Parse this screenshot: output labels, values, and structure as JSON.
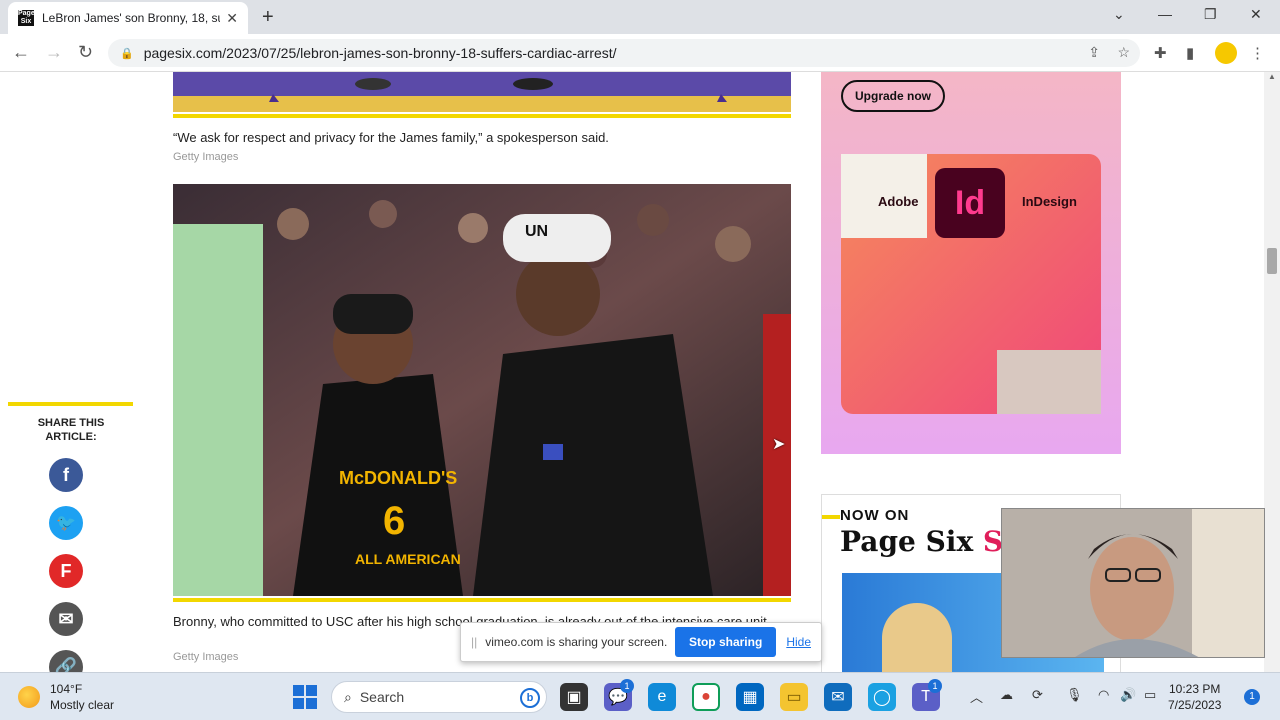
{
  "browser": {
    "tab_title": "LeBron James' son Bronny, 18, su",
    "favicon_text": "Page Six",
    "url": "pagesix.com/2023/07/25/lebron-james-son-bronny-18-suffers-cardiac-arrest/"
  },
  "article": {
    "caption1": "“We ask for respect and privacy for the James family,” a spokesperson said.",
    "credit1": "Getty Images",
    "caption2": "Bronny, who committed to USC after his high school graduation, is already out of the intensive care unit.",
    "credit2": "Getty Images",
    "jersey_text": "McDONALD'S",
    "jersey_number": "6",
    "jersey_sub": "ALL AMERICAN",
    "cap_text": "UN"
  },
  "share": {
    "title": "SHARE THIS ARTICLE:",
    "networks": [
      "facebook",
      "twitter",
      "flipboard",
      "email",
      "link"
    ]
  },
  "ad": {
    "upgrade_label": "Upgrade now",
    "brand_left": "Adobe",
    "logo": "Id",
    "brand_right": "InDesign"
  },
  "promo": {
    "now_on": "NOW ON",
    "brand": "Page Six",
    "brand_suffix": "St"
  },
  "screen_share": {
    "message": "vimeo.com is sharing your screen.",
    "stop_label": "Stop sharing",
    "hide_label": "Hide"
  },
  "taskbar": {
    "temp": "104°F",
    "condition": "Mostly clear",
    "search_label": "Search",
    "time": "10:23 PM",
    "date": "7/25/2023",
    "notification_count": "1",
    "teams_badge": "1",
    "chat_badge": "1"
  }
}
